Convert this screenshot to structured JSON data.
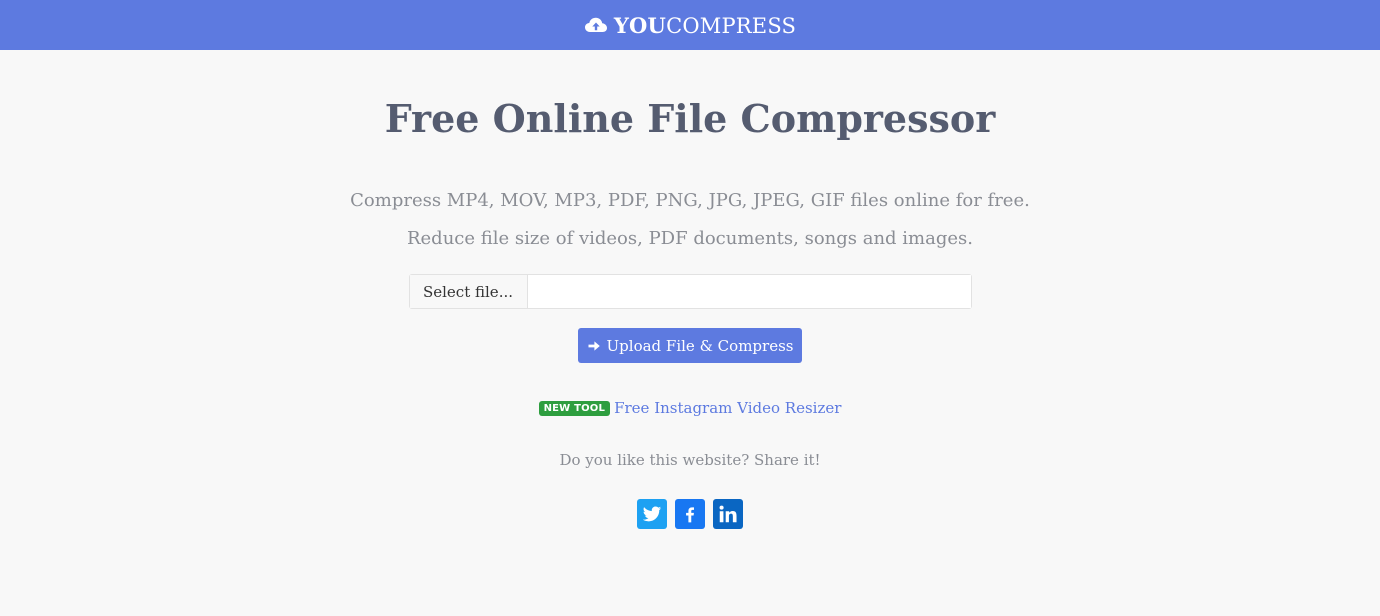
{
  "header": {
    "brand_bold": "YOU",
    "brand_thin": "COMPRESS",
    "icon": "cloud-upload-icon"
  },
  "main": {
    "title": "Free Online File Compressor",
    "description_line1": "Compress MP4, MOV, MP3, PDF, PNG, JPG, JPEG, GIF files online for free.",
    "description_line2": "Reduce file size of videos, PDF documents, songs and images.",
    "select_file_label": "Select file...",
    "file_input_value": "",
    "upload_button_label": "Upload File & Compress",
    "new_tool_badge": "NEW TOOL",
    "new_tool_link": "Free Instagram Video Resizer",
    "share_text": "Do you like this website? Share it!"
  },
  "social": [
    {
      "name": "twitter",
      "icon": "twitter-icon",
      "color": "#1da1f2"
    },
    {
      "name": "facebook",
      "icon": "facebook-icon",
      "color": "#1877f2"
    },
    {
      "name": "linkedin",
      "icon": "linkedin-icon",
      "color": "#0a66c2"
    }
  ],
  "colors": {
    "accent": "#5d7ae0",
    "badge": "#2e9e3f",
    "background": "#f8f8f8"
  }
}
